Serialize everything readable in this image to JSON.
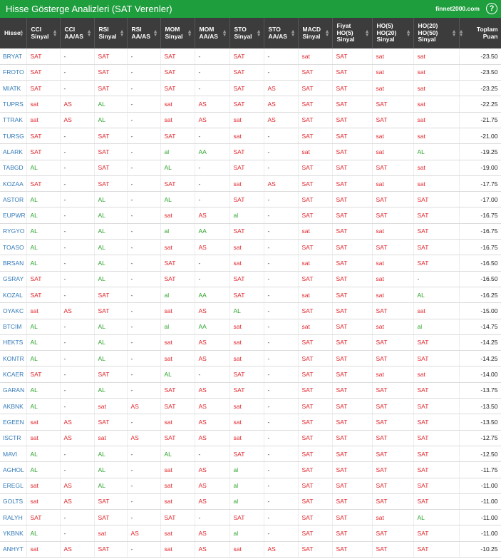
{
  "header": {
    "title": "Hisse Gösterge Analizleri (SAT Verenler)",
    "brand": "finnet2000.com",
    "help_icon": "?"
  },
  "columns": [
    {
      "key": "hisse",
      "lines": [
        "Hisse"
      ]
    },
    {
      "key": "cci_sinyal",
      "lines": [
        "CCI",
        "Sinyal"
      ]
    },
    {
      "key": "cci_aaas",
      "lines": [
        "CCI",
        "AA/AS"
      ]
    },
    {
      "key": "rsi_sinyal",
      "lines": [
        "RSI",
        "Sinyal"
      ]
    },
    {
      "key": "rsi_aaas",
      "lines": [
        "RSI",
        "AA/AS"
      ]
    },
    {
      "key": "mom_sinyal",
      "lines": [
        "MOM",
        "Sinyal"
      ]
    },
    {
      "key": "mom_aaas",
      "lines": [
        "MOM",
        "AA/AS"
      ]
    },
    {
      "key": "sto_sinyal",
      "lines": [
        "STO",
        "Sinyal"
      ]
    },
    {
      "key": "sto_aaas",
      "lines": [
        "STO",
        "AA/AS"
      ]
    },
    {
      "key": "macd_sinyal",
      "lines": [
        "MACD",
        "Sinyal"
      ]
    },
    {
      "key": "fiyat_ho5",
      "lines": [
        "Fiyat",
        "HO(5)",
        "Sinyal"
      ]
    },
    {
      "key": "ho5_ho20",
      "lines": [
        "HO(5)",
        "HO(20)",
        "Sinyal"
      ]
    },
    {
      "key": "ho20_ho50",
      "lines": [
        "HO(20)",
        "HO(50)",
        "Sinyal"
      ]
    },
    {
      "key": "toplam",
      "lines": [
        "Toplam",
        "Puan"
      ]
    }
  ],
  "colors": {
    "sat": "#e0252b",
    "al": "#2aa32a",
    "header_bg": "#3c3c3c",
    "title_bg": "#1f9e3e",
    "symbol": "#337ab7"
  },
  "rows": [
    [
      "BRYAT",
      "SAT",
      "-",
      "SAT",
      "-",
      "SAT",
      "-",
      "SAT",
      "-",
      "sat",
      "SAT",
      "sat",
      "sat",
      "-23.50"
    ],
    [
      "FROTO",
      "SAT",
      "-",
      "SAT",
      "-",
      "SAT",
      "-",
      "SAT",
      "-",
      "SAT",
      "SAT",
      "sat",
      "sat",
      "-23.50"
    ],
    [
      "MIATK",
      "SAT",
      "-",
      "SAT",
      "-",
      "SAT",
      "-",
      "SAT",
      "AS",
      "SAT",
      "SAT",
      "sat",
      "sat",
      "-23.25"
    ],
    [
      "TUPRS",
      "sat",
      "AS",
      "AL",
      "-",
      "sat",
      "AS",
      "SAT",
      "AS",
      "SAT",
      "SAT",
      "SAT",
      "sat",
      "-22.25"
    ],
    [
      "TTRAK",
      "sat",
      "AS",
      "AL",
      "-",
      "sat",
      "AS",
      "sat",
      "AS",
      "SAT",
      "SAT",
      "SAT",
      "sat",
      "-21.75"
    ],
    [
      "TURSG",
      "SAT",
      "-",
      "SAT",
      "-",
      "SAT",
      "-",
      "sat",
      "-",
      "SAT",
      "SAT",
      "sat",
      "sat",
      "-21.00"
    ],
    [
      "ALARK",
      "SAT",
      "-",
      "SAT",
      "-",
      "al",
      "AA",
      "SAT",
      "-",
      "sat",
      "SAT",
      "sat",
      "AL",
      "-19.25"
    ],
    [
      "TABGD",
      "AL",
      "-",
      "SAT",
      "-",
      "AL",
      "-",
      "SAT",
      "-",
      "SAT",
      "SAT",
      "SAT",
      "sat",
      "-19.00"
    ],
    [
      "KOZAA",
      "SAT",
      "-",
      "SAT",
      "-",
      "SAT",
      "-",
      "sat",
      "AS",
      "SAT",
      "SAT",
      "sat",
      "sat",
      "-17.75"
    ],
    [
      "ASTOR",
      "AL",
      "-",
      "AL",
      "-",
      "AL",
      "-",
      "SAT",
      "-",
      "SAT",
      "SAT",
      "SAT",
      "SAT",
      "-17.00"
    ],
    [
      "EUPWR",
      "AL",
      "-",
      "AL",
      "-",
      "sat",
      "AS",
      "al",
      "-",
      "SAT",
      "SAT",
      "SAT",
      "SAT",
      "-16.75"
    ],
    [
      "RYGYO",
      "AL",
      "-",
      "AL",
      "-",
      "al",
      "AA",
      "SAT",
      "-",
      "sat",
      "SAT",
      "sat",
      "SAT",
      "-16.75"
    ],
    [
      "TOASO",
      "AL",
      "-",
      "AL",
      "-",
      "sat",
      "AS",
      "sat",
      "-",
      "SAT",
      "SAT",
      "SAT",
      "SAT",
      "-16.75"
    ],
    [
      "BRSAN",
      "AL",
      "-",
      "AL",
      "-",
      "SAT",
      "-",
      "sat",
      "-",
      "sat",
      "SAT",
      "sat",
      "SAT",
      "-16.50"
    ],
    [
      "GSRAY",
      "SAT",
      "-",
      "AL",
      "-",
      "SAT",
      "-",
      "SAT",
      "-",
      "SAT",
      "SAT",
      "sat",
      "-",
      "-16.50"
    ],
    [
      "KOZAL",
      "SAT",
      "-",
      "SAT",
      "-",
      "al",
      "AA",
      "SAT",
      "-",
      "sat",
      "SAT",
      "sat",
      "AL",
      "-16.25"
    ],
    [
      "OYAKC",
      "sat",
      "AS",
      "SAT",
      "-",
      "sat",
      "AS",
      "AL",
      "-",
      "SAT",
      "SAT",
      "SAT",
      "sat",
      "-15.00"
    ],
    [
      "BTCIM",
      "AL",
      "-",
      "AL",
      "-",
      "al",
      "AA",
      "sat",
      "-",
      "sat",
      "SAT",
      "sat",
      "al",
      "-14.75"
    ],
    [
      "HEKTS",
      "AL",
      "-",
      "AL",
      "-",
      "sat",
      "AS",
      "sat",
      "-",
      "SAT",
      "SAT",
      "SAT",
      "SAT",
      "-14.25"
    ],
    [
      "KONTR",
      "AL",
      "-",
      "AL",
      "-",
      "sat",
      "AS",
      "sat",
      "-",
      "SAT",
      "SAT",
      "SAT",
      "SAT",
      "-14.25"
    ],
    [
      "KCAER",
      "SAT",
      "-",
      "SAT",
      "-",
      "AL",
      "-",
      "SAT",
      "-",
      "SAT",
      "SAT",
      "sat",
      "sat",
      "-14.00"
    ],
    [
      "GARAN",
      "AL",
      "-",
      "AL",
      "-",
      "SAT",
      "AS",
      "SAT",
      "-",
      "SAT",
      "SAT",
      "SAT",
      "SAT",
      "-13.75"
    ],
    [
      "AKBNK",
      "AL",
      "-",
      "sat",
      "AS",
      "SAT",
      "AS",
      "sat",
      "-",
      "SAT",
      "SAT",
      "SAT",
      "SAT",
      "-13.50"
    ],
    [
      "EGEEN",
      "sat",
      "AS",
      "SAT",
      "-",
      "sat",
      "AS",
      "sat",
      "-",
      "SAT",
      "SAT",
      "SAT",
      "SAT",
      "-13.50"
    ],
    [
      "ISCTR",
      "sat",
      "AS",
      "sat",
      "AS",
      "SAT",
      "AS",
      "sat",
      "-",
      "SAT",
      "SAT",
      "SAT",
      "SAT",
      "-12.75"
    ],
    [
      "MAVI",
      "AL",
      "-",
      "AL",
      "-",
      "AL",
      "-",
      "SAT",
      "-",
      "SAT",
      "SAT",
      "SAT",
      "SAT",
      "-12.50"
    ],
    [
      "AGHOL",
      "AL",
      "-",
      "AL",
      "-",
      "sat",
      "AS",
      "al",
      "-",
      "SAT",
      "SAT",
      "SAT",
      "SAT",
      "-11.75"
    ],
    [
      "EREGL",
      "sat",
      "AS",
      "AL",
      "-",
      "sat",
      "AS",
      "al",
      "-",
      "SAT",
      "SAT",
      "SAT",
      "SAT",
      "-11.00"
    ],
    [
      "GOLTS",
      "sat",
      "AS",
      "SAT",
      "-",
      "sat",
      "AS",
      "al",
      "-",
      "SAT",
      "SAT",
      "SAT",
      "SAT",
      "-11.00"
    ],
    [
      "RALYH",
      "SAT",
      "-",
      "SAT",
      "-",
      "SAT",
      "-",
      "SAT",
      "-",
      "SAT",
      "SAT",
      "sat",
      "AL",
      "-11.00"
    ],
    [
      "YKBNK",
      "AL",
      "-",
      "sat",
      "AS",
      "sat",
      "AS",
      "al",
      "-",
      "SAT",
      "SAT",
      "SAT",
      "SAT",
      "-11.00"
    ],
    [
      "ANHYT",
      "sat",
      "AS",
      "SAT",
      "-",
      "sat",
      "AS",
      "sat",
      "AS",
      "SAT",
      "SAT",
      "SAT",
      "SAT",
      "-10.25"
    ]
  ]
}
